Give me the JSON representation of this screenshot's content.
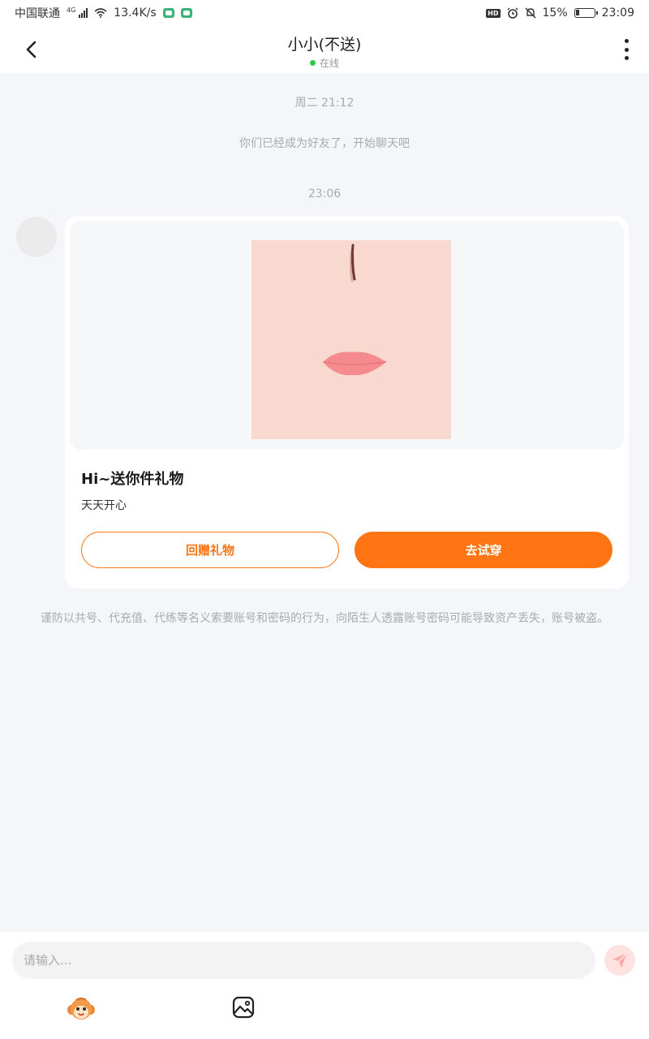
{
  "status_bar": {
    "carrier": "中国联通",
    "network": "4G",
    "speed": "13.4K/s",
    "battery": "15%",
    "time": "23:09",
    "hd_label": "HD"
  },
  "header": {
    "title": "小小(不送)",
    "status": "在线"
  },
  "chat": {
    "time1": "周二 21:12",
    "system_message": "你们已经成为好友了，开始聊天吧",
    "time2": "23:06",
    "gift_card": {
      "title": "Hi~送你件礼物",
      "subtitle": "天天开心",
      "return_button": "回赠礼物",
      "try_button": "去试穿"
    },
    "warning": "谨防以共号、代充值、代练等名义索要账号和密码的行为，向陌生人透露账号密码可能导致资产丢失，账号被盗。"
  },
  "input": {
    "placeholder": "请输入..."
  },
  "icons": {
    "back": "back-arrow-icon",
    "more": "more-vertical-icon",
    "send": "send-icon",
    "emoji": "emoji-icon",
    "image": "image-icon"
  },
  "colors": {
    "accent": "#ff7413",
    "online": "#2ecc40",
    "background": "#f4f6f9"
  }
}
